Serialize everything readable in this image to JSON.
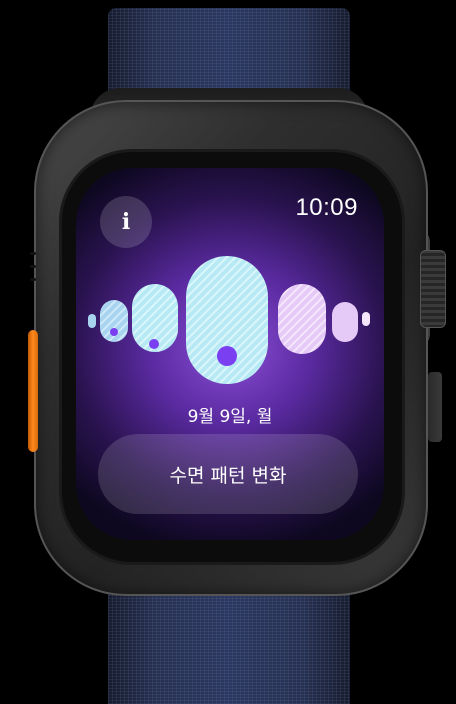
{
  "screen": {
    "time": "10:09",
    "info_icon": "info-icon",
    "date": "9월 9일, 월",
    "trend_button_label": "수면 패턴 변화"
  },
  "sleep_graphic": {
    "description_icon": "sleep-pattern-icon",
    "highlight_color": "#7a3ff0"
  },
  "device": {
    "band_color": "#263052",
    "action_button_color": "#ff8a1e"
  }
}
